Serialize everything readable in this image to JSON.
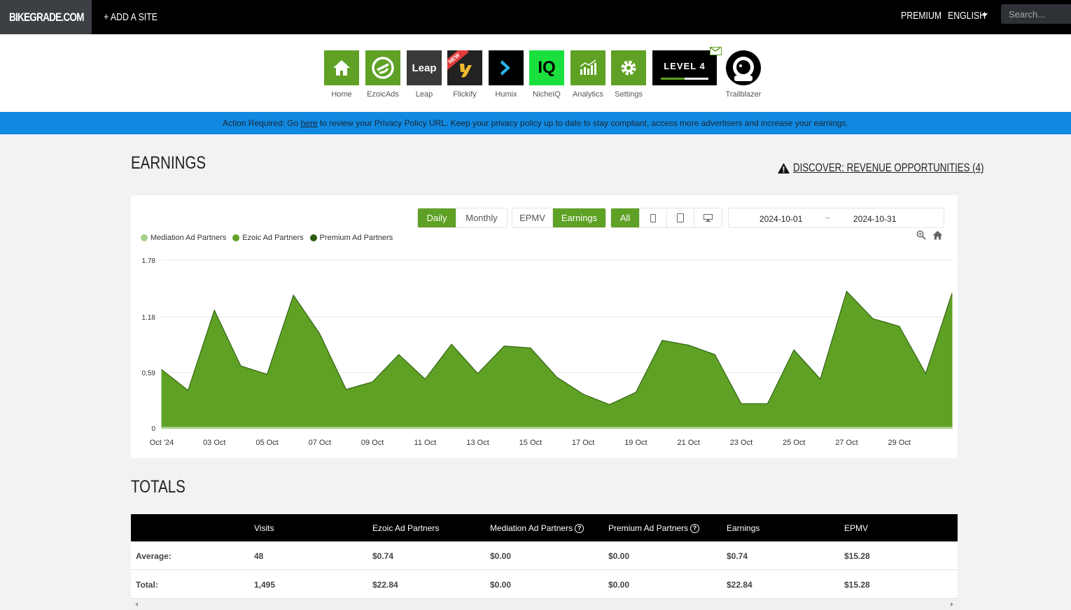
{
  "topbar": {
    "brand": "BIKEGRADE.COM",
    "add_site": "+ ADD A SITE",
    "premium": "PREMIUM",
    "language": "ENGLISH",
    "search_placeholder": "Search..."
  },
  "apps": [
    {
      "label": "Home",
      "icon": "home-icon",
      "color": "#5ea124"
    },
    {
      "label": "EzoicAds",
      "icon": "ezoic-ads-icon",
      "color": "#5ea124"
    },
    {
      "label": "Leap",
      "icon": "leap-icon",
      "color": "#3a3a3a",
      "tile_text": "Leap"
    },
    {
      "label": "Flickify",
      "icon": "flickify-icon",
      "color": "#222222",
      "badge": "NEW"
    },
    {
      "label": "Humix",
      "icon": "humix-icon",
      "color": "#000000"
    },
    {
      "label": "NicheIQ",
      "icon": "nicheiq-icon",
      "color": "#19e03c",
      "tile_text": "IQ"
    },
    {
      "label": "Analytics",
      "icon": "analytics-icon",
      "color": "#5ea124"
    },
    {
      "label": "Settings",
      "icon": "settings-icon",
      "color": "#5ea124"
    },
    {
      "label": "",
      "icon": "level-badge-icon",
      "color": "#000000",
      "tile_text": "LEVEL 4"
    },
    {
      "label": "Trailblazer",
      "icon": "trailblazer-astronaut-icon",
      "color": "#000000"
    }
  ],
  "banner": {
    "prefix": "Action Required: Go ",
    "link": "here",
    "suffix": " to review your Privacy Policy URL. Keep your privacy policy up to date to stay compliant, access more advertisers and increase your earnings."
  },
  "earnings": {
    "title": "EARNINGS",
    "discover": "DISCOVER: REVENUE OPPORTUNITIES (4)",
    "buttons": {
      "daily": "Daily",
      "monthly": "Monthly",
      "epmv": "EPMV",
      "earnings": "Earnings",
      "all": "All"
    },
    "date_from": "2024-10-01",
    "date_sep": "~",
    "date_to": "2024-10-31"
  },
  "chart_data": {
    "type": "area",
    "x": [
      "2024-10-01",
      "2024-10-02",
      "2024-10-03",
      "2024-10-04",
      "2024-10-05",
      "2024-10-06",
      "2024-10-07",
      "2024-10-08",
      "2024-10-09",
      "2024-10-10",
      "2024-10-11",
      "2024-10-12",
      "2024-10-13",
      "2024-10-14",
      "2024-10-15",
      "2024-10-16",
      "2024-10-17",
      "2024-10-18",
      "2024-10-19",
      "2024-10-20",
      "2024-10-21",
      "2024-10-22",
      "2024-10-23",
      "2024-10-24",
      "2024-10-25",
      "2024-10-26",
      "2024-10-27",
      "2024-10-28",
      "2024-10-29",
      "2024-10-30",
      "2024-10-31"
    ],
    "x_tick_labels": [
      "Oct '24",
      "03 Oct",
      "05 Oct",
      "07 Oct",
      "09 Oct",
      "11 Oct",
      "13 Oct",
      "15 Oct",
      "17 Oct",
      "19 Oct",
      "21 Oct",
      "23 Oct",
      "25 Oct",
      "27 Oct",
      "29 Oct"
    ],
    "y_ticks": [
      "0",
      "0.59",
      "1.18",
      "1.78"
    ],
    "ylim": [
      0,
      1.78
    ],
    "series": [
      {
        "name": "Mediation Ad Partners",
        "color": "#a3d18a",
        "values": [
          0,
          0,
          0,
          0,
          0,
          0,
          0,
          0,
          0,
          0,
          0,
          0,
          0,
          0,
          0,
          0,
          0,
          0,
          0,
          0,
          0,
          0,
          0,
          0,
          0,
          0,
          0,
          0,
          0,
          0,
          0
        ]
      },
      {
        "name": "Ezoic Ad Partners",
        "color": "#5ea124",
        "values": [
          0.62,
          0.4,
          1.25,
          0.66,
          0.57,
          1.41,
          1.0,
          0.41,
          0.49,
          0.78,
          0.52,
          0.89,
          0.58,
          0.87,
          0.85,
          0.54,
          0.36,
          0.25,
          0.38,
          0.93,
          0.88,
          0.78,
          0.26,
          0.26,
          0.83,
          0.52,
          1.45,
          1.16,
          1.08,
          0.58,
          1.43
        ]
      },
      {
        "name": "Premium Ad Partners",
        "color": "#2c5a12",
        "values": [
          0,
          0,
          0,
          0,
          0,
          0,
          0,
          0,
          0,
          0,
          0,
          0,
          0,
          0,
          0,
          0,
          0,
          0,
          0,
          0,
          0,
          0,
          0,
          0,
          0,
          0,
          0,
          0,
          0,
          0,
          0
        ]
      }
    ],
    "legend": "top-left",
    "grid": true
  },
  "totals": {
    "title": "TOTALS",
    "headers": [
      "",
      "Visits",
      "Ezoic Ad Partners",
      "Mediation Ad Partners",
      "Premium Ad Partners",
      "Earnings",
      "EPMV"
    ],
    "rows": [
      [
        "Average:",
        "48",
        "$0.74",
        "$0.00",
        "$0.00",
        "$0.74",
        "$15.28"
      ],
      [
        "Total:",
        "1,495",
        "$22.84",
        "$0.00",
        "$0.00",
        "$22.84",
        "$15.28"
      ]
    ]
  }
}
